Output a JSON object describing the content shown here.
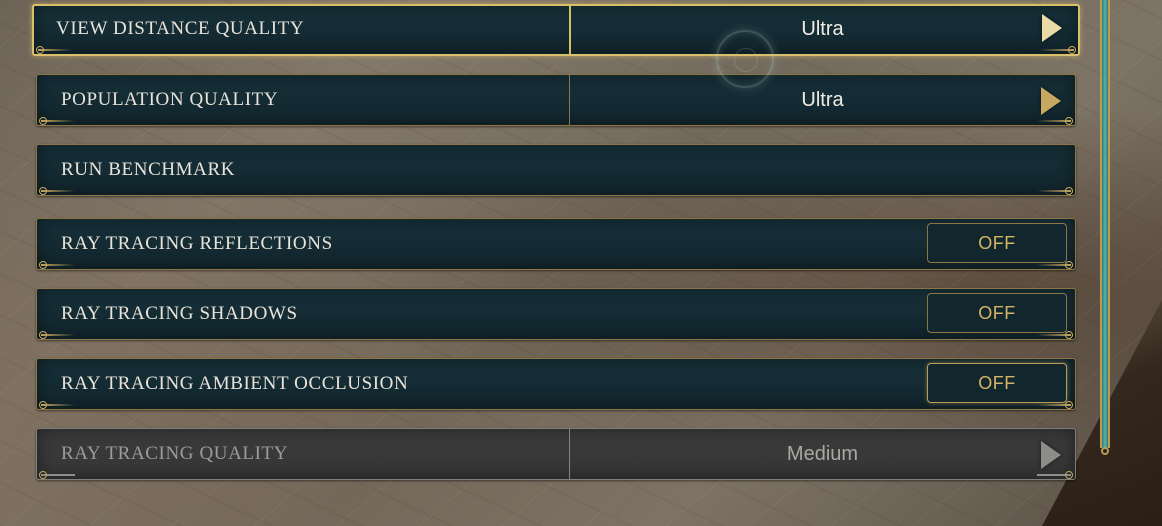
{
  "settings": [
    {
      "label": "VIEW DISTANCE QUALITY",
      "value": "Ultra",
      "control": "selector",
      "selected": true
    },
    {
      "label": "POPULATION QUALITY",
      "value": "Ultra",
      "control": "selector"
    },
    {
      "label": "RUN BENCHMARK",
      "control": "action"
    },
    {
      "label": "RAY TRACING REFLECTIONS",
      "value": "OFF",
      "control": "toggle"
    },
    {
      "label": "RAY TRACING SHADOWS",
      "value": "OFF",
      "control": "toggle"
    },
    {
      "label": "RAY TRACING AMBIENT OCCLUSION",
      "value": "OFF",
      "control": "toggle"
    },
    {
      "label": "RAY TRACING QUALITY",
      "value": "Medium",
      "control": "selector",
      "disabled": true
    }
  ],
  "icons": {
    "selector_arrow": "chevron-right-icon",
    "cursor": "cursor-ring-icon"
  },
  "colors": {
    "row_bg": "#17313a",
    "border_gold": "#8b7644",
    "selected_border": "#d8bf6a",
    "toggle_text": "#d4b566",
    "disabled_bg": "#3b3c3b",
    "scrollbar": "#5cb2a6"
  }
}
